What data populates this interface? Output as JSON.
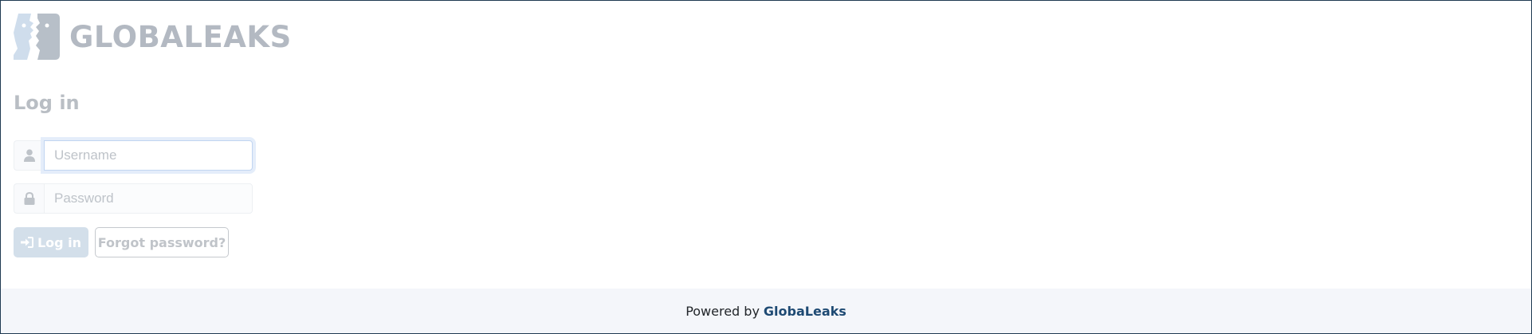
{
  "brand": {
    "name": "GLOBALEAKS",
    "logo_icon": "two-faces-logo-icon"
  },
  "login": {
    "title": "Log in",
    "username": {
      "placeholder": "Username",
      "value": "",
      "icon": "user-icon"
    },
    "password": {
      "placeholder": "Password",
      "value": "",
      "icon": "lock-icon"
    },
    "submit_label": "Log in",
    "submit_icon": "sign-in-icon",
    "forgot_label": "Forgot password?"
  },
  "footer": {
    "powered_by": "Powered by",
    "link_text": "GlobaLeaks"
  },
  "colors": {
    "footer_link": "#1e4a73",
    "submit_button": "#d3dfea",
    "footer_background": "#f4f6fa"
  }
}
